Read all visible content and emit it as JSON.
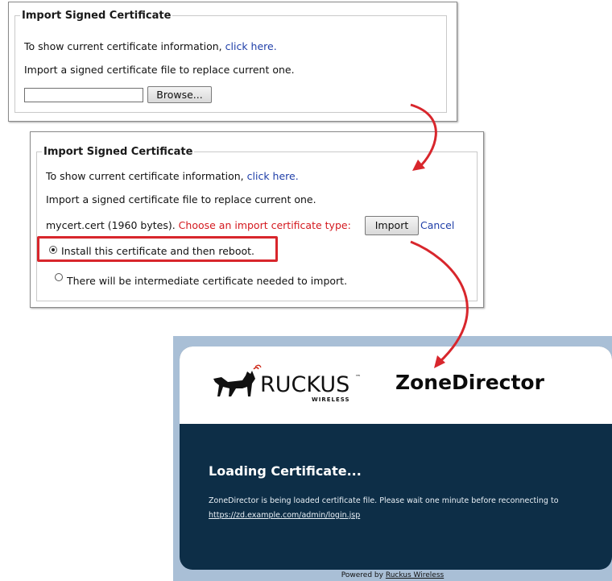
{
  "panel1": {
    "legend": "Import Signed Certificate",
    "show_info_text": "To show current certificate information,",
    "show_info_link": "click here.",
    "import_text": "Import a signed certificate file to replace current one.",
    "file_value": "",
    "browse_label": "Browse..."
  },
  "panel2": {
    "legend": "Import Signed Certificate",
    "show_info_text": "To show current certificate information,",
    "show_info_link": "click here.",
    "import_text": "Import a signed certificate file to replace current one.",
    "file_info": "mycert.cert (1960 bytes).",
    "choose_type": "Choose an import certificate type:",
    "import_label": "Import",
    "cancel_label": "Cancel",
    "options": [
      {
        "label": "Install this certificate and then reboot.",
        "selected": true
      },
      {
        "label": "There will be intermediate certificate needed to import.",
        "selected": false
      }
    ]
  },
  "zonedirector": {
    "brand": "RUCKUS",
    "brand_tm": "™",
    "brand_sub": "WIRELESS",
    "title": "ZoneDirector",
    "heading": "Loading Certificate...",
    "message": "ZoneDirector is being loaded certificate file. Please wait one minute before reconnecting to",
    "url": "https://zd.example.com/admin/login.jsp",
    "footer_prefix": "Powered by",
    "footer_link": "Ruckus Wireless"
  },
  "colors": {
    "highlight": "#d8262c",
    "link": "#1f3ea8",
    "warning_text": "#d4191f",
    "zd_dark": "#0d2e47"
  }
}
